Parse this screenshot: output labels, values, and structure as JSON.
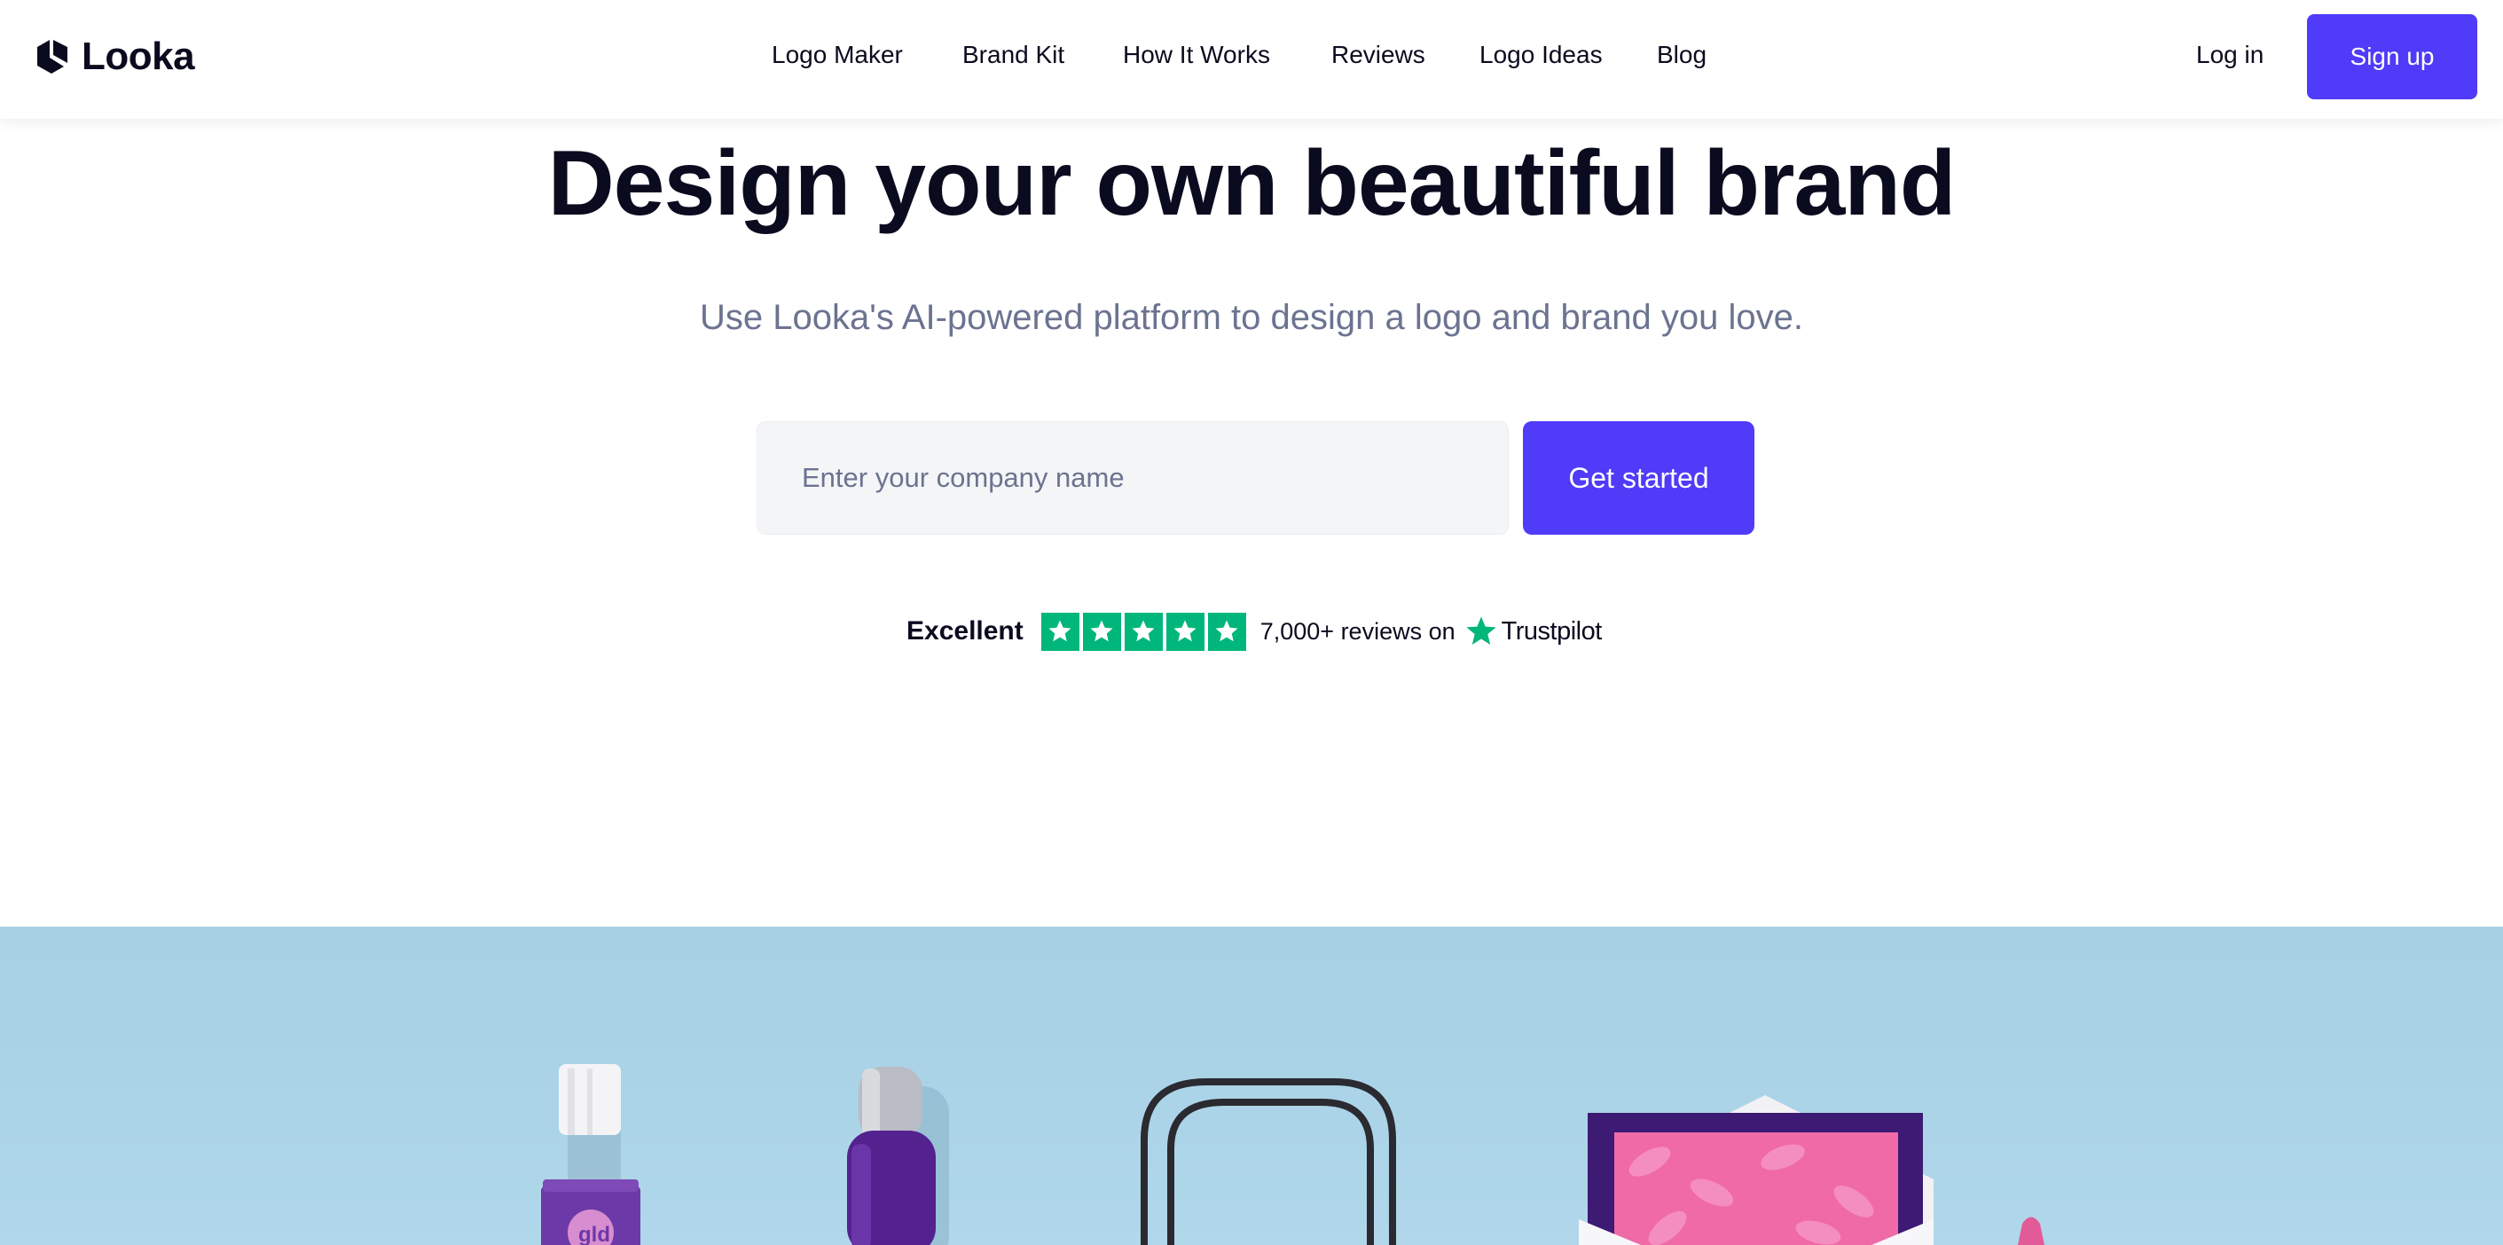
{
  "brand": {
    "name": "Looka"
  },
  "nav": {
    "items": [
      {
        "label": "Logo Maker"
      },
      {
        "label": "Brand Kit"
      },
      {
        "label": "How It Works"
      },
      {
        "label": "Reviews"
      },
      {
        "label": "Logo Ideas"
      },
      {
        "label": "Blog"
      }
    ],
    "login_label": "Log in",
    "signup_label": "Sign up"
  },
  "hero": {
    "title": "Design your own beautiful brand",
    "subtitle": "Use Looka's AI-powered platform to design a logo and brand you love.",
    "input_placeholder": "Enter your company name",
    "input_value": "",
    "cta_label": "Get started"
  },
  "trustpilot": {
    "rating_label": "Excellent",
    "stars": 5,
    "reviews_text": "7,000+ reviews on",
    "brand": "Trustpilot"
  },
  "colors": {
    "accent": "#4f3bf8",
    "trust_green": "#00b67a",
    "subtitle_gray": "#6b7390",
    "photo_bg": "#a9d2e6",
    "product_purple": "#5b2a9c",
    "product_pink": "#f06aa8"
  },
  "icons": {
    "logo": "looka-hexagon-logo-icon",
    "star": "star-icon"
  }
}
